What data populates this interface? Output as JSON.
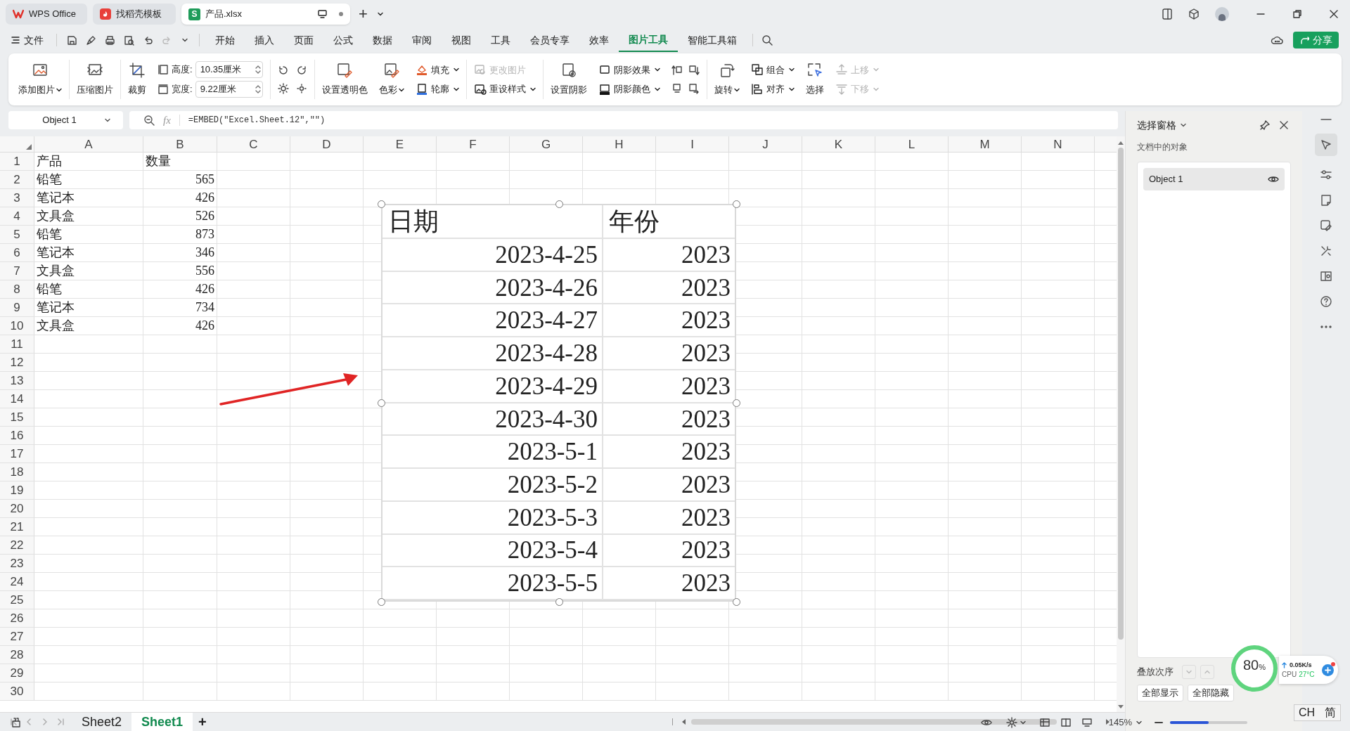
{
  "tabs": [
    {
      "label": "WPS Office",
      "kind": "wps",
      "selected": false
    },
    {
      "label": "找稻壳模板",
      "kind": "docer",
      "selected": false
    },
    {
      "label": "产品.xlsx",
      "kind": "sheet",
      "badge": "S",
      "selected": true
    }
  ],
  "new_tab": "+",
  "menu": {
    "file": "文件",
    "items": [
      {
        "label": "开始",
        "selected": false
      },
      {
        "label": "插入",
        "selected": false
      },
      {
        "label": "页面",
        "selected": false
      },
      {
        "label": "公式",
        "selected": false
      },
      {
        "label": "数据",
        "selected": false
      },
      {
        "label": "审阅",
        "selected": false
      },
      {
        "label": "视图",
        "selected": false
      },
      {
        "label": "工具",
        "selected": false
      },
      {
        "label": "会员专享",
        "selected": false
      },
      {
        "label": "效率",
        "selected": false
      },
      {
        "label": "图片工具",
        "selected": true
      },
      {
        "label": "智能工具箱",
        "selected": false
      }
    ]
  },
  "share_button": "分享",
  "ribbon": [
    [
      {
        "kind": "big",
        "label": "添加图片",
        "dropdown": true
      }
    ],
    [
      {
        "kind": "big",
        "label": "压缩图片"
      }
    ],
    [
      {
        "kind": "big",
        "label": "裁剪"
      },
      {
        "kind": "size",
        "fields": [
          {
            "label": "高度:",
            "value": "10.35厘米"
          },
          {
            "label": "宽度:",
            "value": "9.22厘米"
          }
        ]
      }
    ],
    [
      {
        "kind": "adjust"
      }
    ],
    [
      {
        "kind": "big",
        "label": "设置透明色"
      },
      {
        "kind": "big",
        "label": "色彩",
        "dropdown": true
      },
      {
        "kind": "stack",
        "items": [
          {
            "label": "填充",
            "dropdown": true,
            "disabled": false
          },
          {
            "label": "轮廓",
            "dropdown": true,
            "disabled": false
          }
        ]
      }
    ],
    [
      {
        "kind": "stack",
        "items": [
          {
            "label": "更改图片",
            "disabled": true
          },
          {
            "label": "重设样式",
            "dropdown": true,
            "disabled": false
          }
        ]
      }
    ],
    [
      {
        "kind": "big",
        "label": "设置阴影"
      },
      {
        "kind": "stack",
        "items": [
          {
            "label": "阴影效果",
            "dropdown": true,
            "disabled": false
          },
          {
            "label": "阴影颜色",
            "dropdown": true,
            "disabled": false
          }
        ]
      },
      {
        "kind": "nudge"
      }
    ],
    [
      {
        "kind": "big",
        "label": "旋转",
        "dropdown": true
      },
      {
        "kind": "stack",
        "items": [
          {
            "label": "组合",
            "dropdown": true,
            "disabled": false
          },
          {
            "label": "对齐",
            "dropdown": true,
            "disabled": false
          }
        ]
      },
      {
        "kind": "big",
        "label": "选择"
      },
      {
        "kind": "stack",
        "items": [
          {
            "label": "上移",
            "dropdown": true,
            "disabled": true
          },
          {
            "label": "下移",
            "dropdown": true,
            "disabled": true
          }
        ]
      }
    ]
  ],
  "formula_bar": {
    "name_box": "Object 1",
    "function_label": "fx",
    "formula": "=EMBED(\"Excel.Sheet.12\",\"\")"
  },
  "columns": [
    "A",
    "B",
    "C",
    "D",
    "E",
    "F",
    "G",
    "H",
    "I",
    "J",
    "K",
    "L",
    "M",
    "N"
  ],
  "row_numbers": [
    "1",
    "2",
    "3",
    "4",
    "5",
    "6",
    "7",
    "8",
    "9",
    "10",
    "11",
    "12",
    "13",
    "14",
    "15",
    "16",
    "17",
    "18",
    "19",
    "20",
    "21",
    "22",
    "23",
    "24",
    "25",
    "26",
    "27",
    "28",
    "29",
    "30"
  ],
  "cells": [
    [
      "产品",
      "数量"
    ],
    [
      "铅笔",
      "565"
    ],
    [
      "笔记本",
      "426"
    ],
    [
      "文具盒",
      "526"
    ],
    [
      "铅笔",
      "873"
    ],
    [
      "笔记本",
      "346"
    ],
    [
      "文具盒",
      "556"
    ],
    [
      "铅笔",
      "426"
    ],
    [
      "笔记本",
      "734"
    ],
    [
      "文具盒",
      "426"
    ]
  ],
  "embedded_table": {
    "columns": [
      "日期",
      "年份"
    ],
    "rows": [
      [
        "2023-4-25",
        "2023"
      ],
      [
        "2023-4-26",
        "2023"
      ],
      [
        "2023-4-27",
        "2023"
      ],
      [
        "2023-4-28",
        "2023"
      ],
      [
        "2023-4-29",
        "2023"
      ],
      [
        "2023-4-30",
        "2023"
      ],
      [
        "2023-5-1",
        "2023"
      ],
      [
        "2023-5-2",
        "2023"
      ],
      [
        "2023-5-3",
        "2023"
      ],
      [
        "2023-5-4",
        "2023"
      ],
      [
        "2023-5-5",
        "2023"
      ]
    ]
  },
  "selection_pane": {
    "title": "选择窗格",
    "section": "文档中的对象",
    "objects": [
      {
        "label": "Object 1",
        "visible": true
      }
    ],
    "order_label": "叠放次序",
    "buttons": [
      "全部显示",
      "全部隐藏"
    ]
  },
  "sheet_tabs": [
    {
      "label": "Sheet2",
      "selected": false
    },
    {
      "label": "Sheet1",
      "selected": true
    }
  ],
  "add_sheet": "+",
  "status_bar": {
    "zoom": "145%",
    "zoom_slider": {
      "level": 0.5
    }
  },
  "monitor_widget": {
    "percent": "80",
    "percent_unit": "%",
    "speed": "0.05K/s",
    "cpu_label": "CPU",
    "cpu_temp": "27°C"
  },
  "ime_indicator": [
    "CH",
    "简"
  ]
}
